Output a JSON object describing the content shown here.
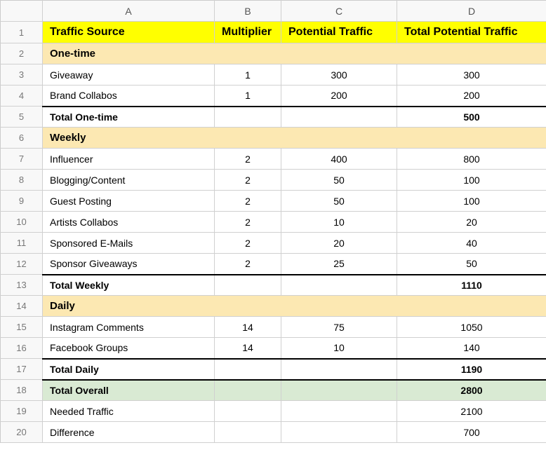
{
  "columnLetters": [
    "A",
    "B",
    "C",
    "D"
  ],
  "rowNumbers": [
    "1",
    "2",
    "3",
    "4",
    "5",
    "6",
    "7",
    "8",
    "9",
    "10",
    "11",
    "12",
    "13",
    "14",
    "15",
    "16",
    "17",
    "18",
    "19",
    "20"
  ],
  "headers": {
    "a": "Traffic Source",
    "b": "Multiplier",
    "c": "Potential Traffic",
    "d": "Total Potential Traffic"
  },
  "sections": {
    "onetime": "One-time",
    "weekly": "Weekly",
    "daily": "Daily"
  },
  "rows": {
    "giveaway": {
      "a": "Giveaway",
      "b": "1",
      "c": "300",
      "d": "300"
    },
    "brand": {
      "a": "Brand Collabos",
      "b": "1",
      "c": "200",
      "d": "200"
    },
    "influencer": {
      "a": "Influencer",
      "b": "2",
      "c": "400",
      "d": "800"
    },
    "blogging": {
      "a": "Blogging/Content",
      "b": "2",
      "c": "50",
      "d": "100"
    },
    "guest": {
      "a": "Guest Posting",
      "b": "2",
      "c": "50",
      "d": "100"
    },
    "artists": {
      "a": "Artists Collabos",
      "b": "2",
      "c": "10",
      "d": "20"
    },
    "emails": {
      "a": "Sponsored E-Mails",
      "b": "2",
      "c": "20",
      "d": "40"
    },
    "sponsorgive": {
      "a": "Sponsor Giveaways",
      "b": "2",
      "c": "25",
      "d": "50"
    },
    "instagram": {
      "a": "Instagram Comments",
      "b": "14",
      "c": "75",
      "d": "1050"
    },
    "facebook": {
      "a": "Facebook Groups",
      "b": "14",
      "c": "10",
      "d": "140"
    }
  },
  "totals": {
    "onetime": {
      "label": "Total One-time",
      "value": "500"
    },
    "weekly": {
      "label": "Total Weekly",
      "value": "1110"
    },
    "daily": {
      "label": "Total Daily",
      "value": "1190"
    },
    "overall": {
      "label": "Total Overall",
      "value": "2800"
    },
    "needed": {
      "label": "Needed Traffic",
      "value": "2100"
    },
    "diff": {
      "label": "Difference",
      "value": "700"
    }
  }
}
